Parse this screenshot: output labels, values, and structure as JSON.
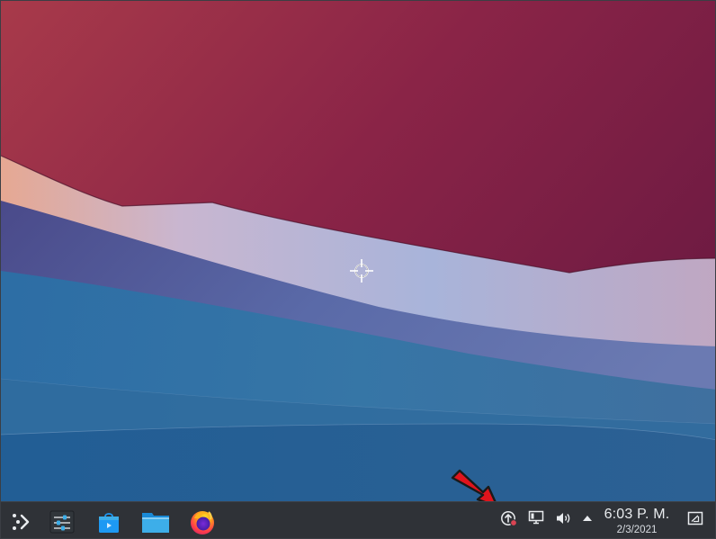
{
  "desktop": {
    "wallpaper": "KDE Plasma default wallpaper",
    "colors": {
      "wine": "#7a1f3d",
      "lavender": "#b8bfe0",
      "blue": "#2f6a9a",
      "panel": "#2f3237",
      "annotation_arrow": "#e0141c"
    }
  },
  "taskbar": {
    "launcher_icon": "app-launcher-icon",
    "apps": [
      {
        "name": "System Settings",
        "icon": "settings-sliders-icon"
      },
      {
        "name": "Discover",
        "icon": "discover-bag-icon"
      },
      {
        "name": "Dolphin",
        "icon": "folder-icon"
      },
      {
        "name": "Firefox",
        "icon": "firefox-icon"
      }
    ],
    "tray": {
      "items": [
        "update-notifier-icon",
        "network-wired-icon",
        "volume-icon",
        "expand-tray-arrow-icon"
      ]
    },
    "clock": {
      "time": "6:03 P. M.",
      "date": "2/3/2021"
    },
    "show_desktop_icon": "show-desktop-icon"
  }
}
